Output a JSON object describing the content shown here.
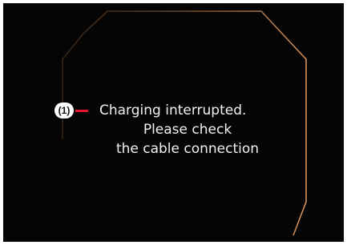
{
  "callout": {
    "number": "(1)"
  },
  "message": {
    "line1": "Charging interrupted.",
    "line2": "Please check",
    "line3": "the cable connection"
  },
  "colors": {
    "background": "#050505",
    "frame_outline": "#c9874a",
    "callout_line": "#e8152e",
    "text": "#f2f2f2"
  }
}
